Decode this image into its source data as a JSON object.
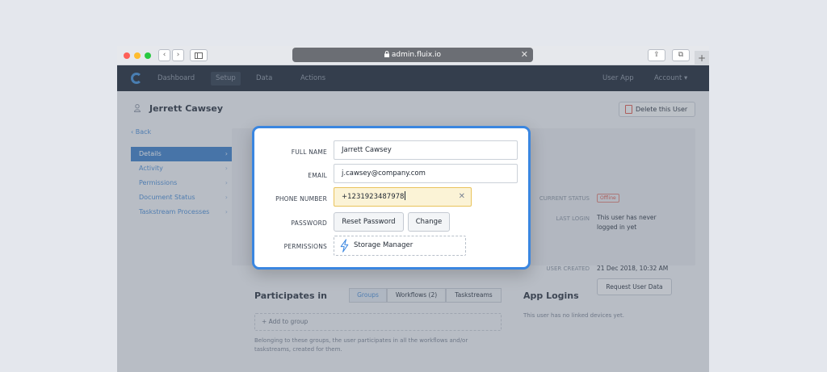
{
  "browser": {
    "url": "admin.fluix.io",
    "close_glyph": "✕",
    "newtab_glyph": "+",
    "back_glyph": "‹",
    "forward_glyph": "›",
    "share_glyph": "⇪",
    "tabs_glyph": "⧉"
  },
  "nav": {
    "items": [
      "Dashboard",
      "Setup",
      "Data",
      "Actions"
    ],
    "active": "Setup",
    "right": [
      "User App",
      "Account ▾"
    ]
  },
  "page": {
    "user_name": "Jerrett Cawsey",
    "delete_label": "Delete this User",
    "back_label": "‹  Back",
    "sidebar_items": [
      "Details",
      "Activity",
      "Permissions",
      "Document Status",
      "Taskstream Processes"
    ],
    "sidebar_active": "Details",
    "current_status_label": "CURRENT STATUS",
    "current_status_value": "Offline",
    "last_login_label": "LAST LOGIN",
    "last_login_value": "This user has never logged in yet",
    "user_created_label": "USER CREATED",
    "user_created_value": "21 Dec 2018, 10:32 AM",
    "request_data_label": "Request User Data",
    "participates_title": "Participates in",
    "segments": [
      "Groups",
      "Workflows (2)",
      "Taskstreams"
    ],
    "segment_active": "Groups",
    "add_group_label": "+    Add to group",
    "participates_note": "Belonging to these groups, the user participates in all the workflows and/or taskstreams, created for them.",
    "app_logins_title": "App Logins",
    "app_logins_note": "This user has no linked devices yet."
  },
  "modal": {
    "full_name_label": "FULL NAME",
    "full_name_value": "Jarrett Cawsey",
    "email_label": "EMAIL",
    "email_value": "j.cawsey@company.com",
    "phone_label": "PHONE NUMBER",
    "phone_value": "+1231923487978",
    "clear_glyph": "✕",
    "password_label": "PASSWORD",
    "reset_label": "Reset Password",
    "change_label": "Change",
    "permissions_label": "PERMISSIONS",
    "permissions_value": "Storage Manager"
  },
  "colors": {
    "accent": "#3a86e0",
    "navbar": "#1e2836",
    "focus_bg": "#fbf3d6",
    "danger": "#e05a4e"
  },
  "icons": [
    "lock-icon",
    "logo-icon",
    "user-icon",
    "trash-icon",
    "bolt-icon",
    "chevron-right-icon",
    "clear-icon"
  ]
}
